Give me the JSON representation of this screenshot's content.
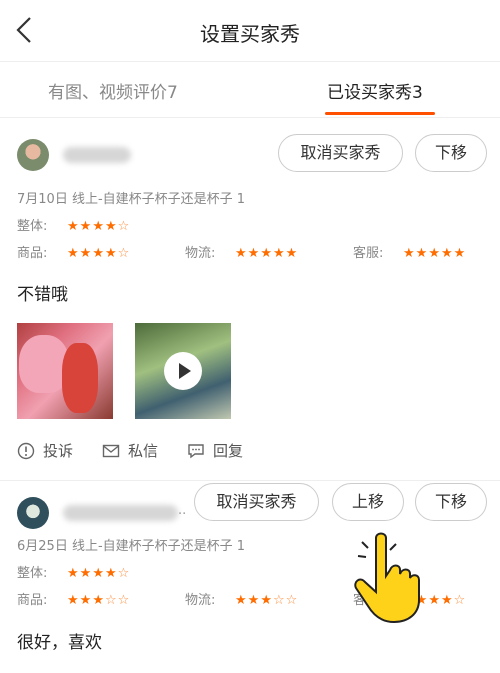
{
  "header": {
    "title": "设置买家秀",
    "back_icon": "back-chevron-icon"
  },
  "tabs": [
    {
      "label": "有图、视频评价7",
      "active": false
    },
    {
      "label": "已设买家秀3",
      "active": true
    }
  ],
  "accent_color": "#ff5000",
  "star_color": "#ff6d00",
  "reviews": [
    {
      "meta": "7月10日   线上-自建杯子杯子还是杯子   1",
      "overall": {
        "label": "整体:",
        "stars": 4
      },
      "sub": [
        {
          "label": "商品:",
          "stars": 4
        },
        {
          "label": "物流:",
          "stars": 5
        },
        {
          "label": "客服:",
          "stars": 5
        }
      ],
      "content": "不错哦",
      "buttons": {
        "cancel": "取消买家秀",
        "down": "下移"
      },
      "actions": {
        "report": "投诉",
        "message": "私信",
        "reply": "回复"
      }
    },
    {
      "name_suffix": "..",
      "meta": "6月25日   线上-自建杯子杯子还是杯子   1",
      "overall": {
        "label": "整体:",
        "stars": 4
      },
      "sub": [
        {
          "label": "商品:",
          "stars": 3
        },
        {
          "label": "物流:",
          "stars": 3
        },
        {
          "label": "客服:",
          "stars": 4
        }
      ],
      "content": "很好，喜欢",
      "buttons": {
        "cancel": "取消买家秀",
        "up": "上移",
        "down": "下移"
      }
    }
  ]
}
